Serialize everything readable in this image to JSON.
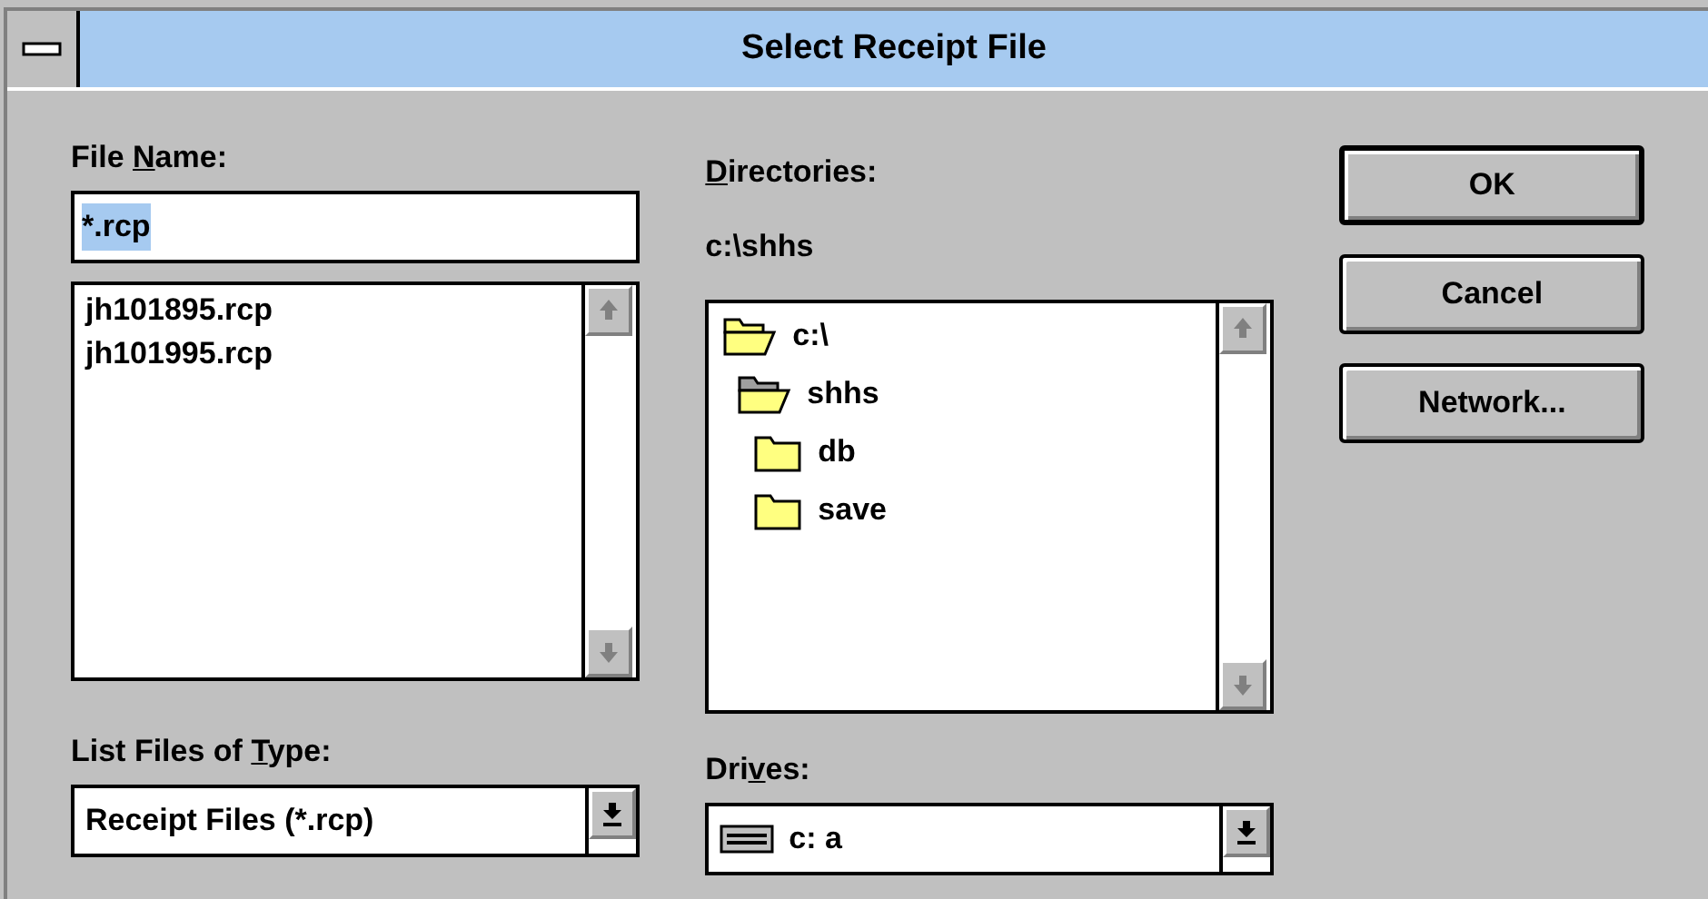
{
  "window": {
    "title": "Select Receipt File"
  },
  "file_name": {
    "label": {
      "before": "File ",
      "key": "N",
      "after": "ame:"
    },
    "value": "*.rcp",
    "text_selected": true
  },
  "files": [
    {
      "name": "jh101895.rcp",
      "selected": false
    },
    {
      "name": "jh101995.rcp",
      "selected": false
    }
  ],
  "file_type": {
    "label": {
      "before": "List Files of ",
      "key": "T",
      "after": "ype:"
    },
    "value": "Receipt Files (*.rcp)"
  },
  "directories": {
    "label": {
      "key": "D",
      "after": "irectories:"
    },
    "path": "c:\\shhs",
    "tree": [
      {
        "name": "c:\\",
        "open": true,
        "current": false,
        "children": [
          {
            "name": "shhs",
            "open": true,
            "current": true,
            "children": [
              {
                "name": "db",
                "open": false,
                "current": false
              },
              {
                "name": "save",
                "open": false,
                "current": false
              }
            ]
          }
        ]
      }
    ]
  },
  "drives": {
    "label": {
      "before": "Dri",
      "key": "v",
      "after": "es:"
    },
    "value": "c: a"
  },
  "buttons": [
    {
      "label": "OK",
      "default": true
    },
    {
      "label": "Cancel",
      "default": false
    },
    {
      "label": "Network...",
      "default": false
    }
  ]
}
